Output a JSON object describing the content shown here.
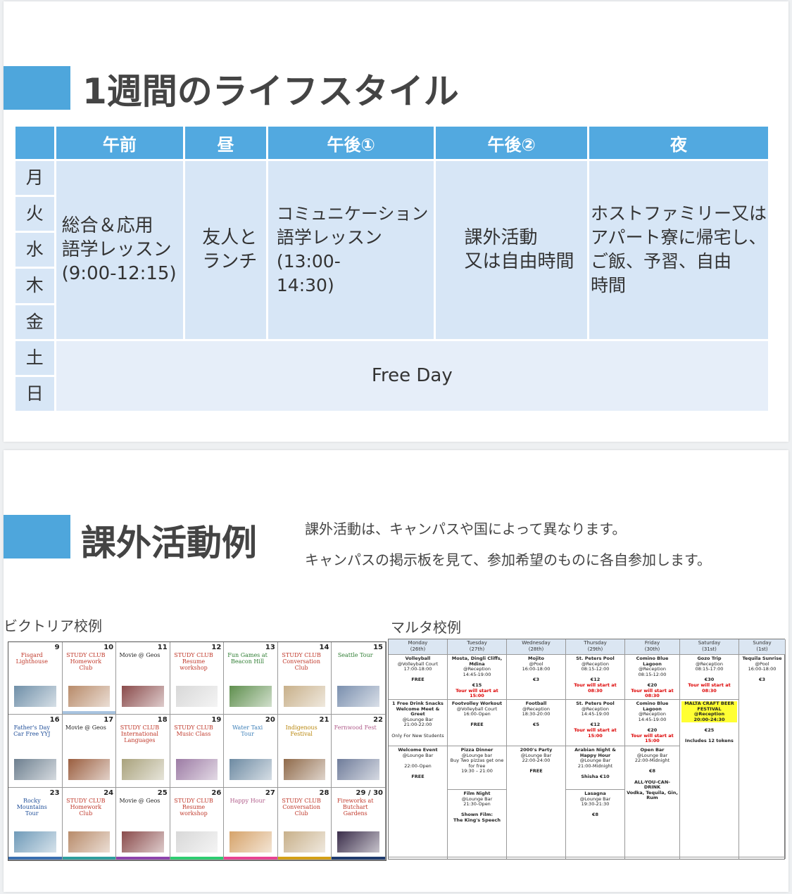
{
  "slide1": {
    "title": "1週間のライフスタイル",
    "headers": [
      "午前",
      "昼",
      "午後①",
      "午後②",
      "夜"
    ],
    "days": [
      "月",
      "火",
      "水",
      "木",
      "金",
      "土",
      "日"
    ],
    "cells": {
      "am": [
        "総合＆応用",
        "語学レッスン",
        "(9:00-12:15)"
      ],
      "noon": [
        "友人と",
        "ランチ"
      ],
      "pm1": [
        "コミュニケーション",
        "語学レッスン",
        "(13:00-",
        "14:30)"
      ],
      "pm2": [
        "課外活動",
        "又は自由時間"
      ],
      "night": [
        "ホストファミリー又は",
        "アパート寮に帰宅し、",
        "ご飯、予習、自由",
        "時間"
      ]
    },
    "free_day": "Free Day"
  },
  "slide2": {
    "title": "課外活動例",
    "desc1": "課外活動は、キャンパスや国によって異なります。",
    "desc2": "キャンパスの掲示板を見て、参加希望のものに各自参加します。",
    "victoria_label": "ビクトリア校例",
    "malta_label": "マルタ校例",
    "victoria_cells": [
      {
        "day": "9",
        "event": "Fisgard Lighthouse",
        "color": "#c0392b"
      },
      {
        "day": "10",
        "event": "STUDY CLUB Homework Club",
        "color": "#c0392b"
      },
      {
        "day": "11",
        "event": "Movie @ Geos",
        "color": "#222222"
      },
      {
        "day": "12",
        "event": "STUDY CLUB Resume workshop",
        "color": "#c0392b"
      },
      {
        "day": "13",
        "event": "Fun Games at Beacon Hill",
        "color": "#2e7d32"
      },
      {
        "day": "14",
        "event": "STUDY CLUB Conversation Club",
        "color": "#c0392b"
      },
      {
        "day": "15",
        "event": "Seattle Tour",
        "color": "#2e7d32"
      },
      {
        "day": "16",
        "event": "Father's Day Car Free YYJ",
        "color": "#1f4e99"
      },
      {
        "day": "17",
        "event": "Movie @ Geos",
        "color": "#222222"
      },
      {
        "day": "18",
        "event": "STUDY CLUB International Languages",
        "color": "#c0392b"
      },
      {
        "day": "19",
        "event": "STUDY CLUB Music Class",
        "color": "#c0392b"
      },
      {
        "day": "20",
        "event": "Water Taxi Tour",
        "color": "#3c7fb8"
      },
      {
        "day": "21",
        "event": "Indigenous Festival",
        "color": "#b8860b"
      },
      {
        "day": "22",
        "event": "Fernwood Fest",
        "color": "#b05c8a"
      },
      {
        "day": "23",
        "event": "Rocky Mountains Tour",
        "color": "#1f4e99"
      },
      {
        "day": "24",
        "event": "STUDY CLUB Homework Club",
        "color": "#c0392b"
      },
      {
        "day": "25",
        "event": "Movie @ Geos",
        "color": "#222222"
      },
      {
        "day": "26",
        "event": "STUDY CLUB Resume workshop",
        "color": "#c0392b"
      },
      {
        "day": "27",
        "event": "Happy Hour",
        "color": "#b05c8a"
      },
      {
        "day": "28",
        "event": "STUDY CLUB Conversation Club",
        "color": "#c0392b"
      },
      {
        "day": "29 / 30",
        "event": "Fireworks at Butchart Gardens",
        "color": "#c0392b"
      }
    ],
    "malta_headers": [
      {
        "day": "Monday",
        "date": "(26th)"
      },
      {
        "day": "Tuesday",
        "date": "(27th)"
      },
      {
        "day": "Wednesday",
        "date": "(28th)"
      },
      {
        "day": "Thursday",
        "date": "(29th)"
      },
      {
        "day": "Friday",
        "date": "(30th)"
      },
      {
        "day": "Saturday",
        "date": "(31st)"
      },
      {
        "day": "Sunday",
        "date": "(1st)"
      }
    ],
    "malta_columns": [
      [
        {
          "name": "Volleyball",
          "lines": [
            "@Volleyball Court",
            "17:00-18:00",
            "",
            "FREE"
          ]
        },
        {
          "name": "1 Free Drink Snacks Welcome Meet & Greet",
          "lines": [
            "@Lounge Bar",
            "21:00-22:00",
            "",
            "Only For New Students"
          ]
        },
        {
          "name": "Welcome Event",
          "lines": [
            "@Lounge Bar",
            "",
            "22:00-Open",
            "",
            "FREE"
          ]
        }
      ],
      [
        {
          "name": "Mosta, Dingli Cliffs, Mdina",
          "lines": [
            "@Reception",
            "14:45-19:00",
            "",
            "€15"
          ],
          "red": "Tour will start at 15:00"
        },
        {
          "name": "Footvolley Workout",
          "lines": [
            "@Volleyball Court",
            "16:00-Open",
            "",
            "FREE"
          ]
        },
        {
          "name": "Pizza Dinner",
          "lines": [
            "@Lounge bar",
            "Buy Two pizzas get one for free",
            "19:30 – 21:00"
          ]
        },
        {
          "name": "Film Night",
          "lines": [
            "@Lounge Bar",
            "21:30-Open",
            "",
            "Shown Film:",
            "The King's Speech"
          ]
        }
      ],
      [
        {
          "name": "Mojito",
          "lines": [
            "@Pool",
            "16:00-18:00",
            "",
            "€3"
          ]
        },
        {
          "name": "Football",
          "lines": [
            "@Reception",
            "18:30-20:00",
            "",
            "€5"
          ]
        },
        {
          "name": "2000's Party",
          "lines": [
            "@Lounge Bar",
            "22:00-24:00",
            "",
            "FREE"
          ]
        }
      ],
      [
        {
          "name": "St. Peters Pool",
          "lines": [
            "@Reception",
            "08:15-12:00",
            "",
            "€12"
          ],
          "red": "Tour will start at 08:30"
        },
        {
          "name": "St. Peters Pool",
          "lines": [
            "@Reception",
            "14:45-19:00",
            "",
            "€12"
          ],
          "red": "Tour will start at 15:00"
        },
        {
          "name": "Arabian Night & Happy Hour",
          "lines": [
            "@Lounge Bar",
            "21:00-Midnight",
            "",
            "Shisha €10"
          ]
        },
        {
          "name": "Lasagna",
          "lines": [
            "@Lounge Bar",
            "19:30-21:30",
            "",
            "€8"
          ]
        }
      ],
      [
        {
          "name": "Comino Blue Lagoon",
          "lines": [
            "@Reception",
            "08:15-12:00",
            "",
            "€20"
          ],
          "red": "Tour will start at 08:30"
        },
        {
          "name": "Comino Blue Lagoon",
          "lines": [
            "@Reception",
            "14:45-19:00",
            "",
            "€20"
          ],
          "red": "Tour will start at 15:00"
        },
        {
          "name": "Open Bar",
          "lines": [
            "@Lounge Bar",
            "22:00-Midnight",
            "",
            "€8",
            "",
            "ALL-YOU-CAN-DRINK",
            "Vodka, Tequila, Gin, Rum"
          ]
        }
      ],
      [
        {
          "name": "Gozo Trip",
          "lines": [
            "@Reception",
            "08:15-17:00",
            "",
            "€30"
          ],
          "red": "Tour will start at 08:30"
        },
        {
          "name": "MALTA CRAFT BEER FESTIVAL",
          "lines": [
            "@Reception",
            "20:00-24:30",
            "",
            "€25",
            "",
            "Includes 12 tokens"
          ],
          "highlight": true
        }
      ],
      [
        {
          "name": "Tequila Sunrise",
          "lines": [
            "@Pool",
            "16:00-18:00",
            "",
            "€3"
          ]
        }
      ]
    ]
  }
}
